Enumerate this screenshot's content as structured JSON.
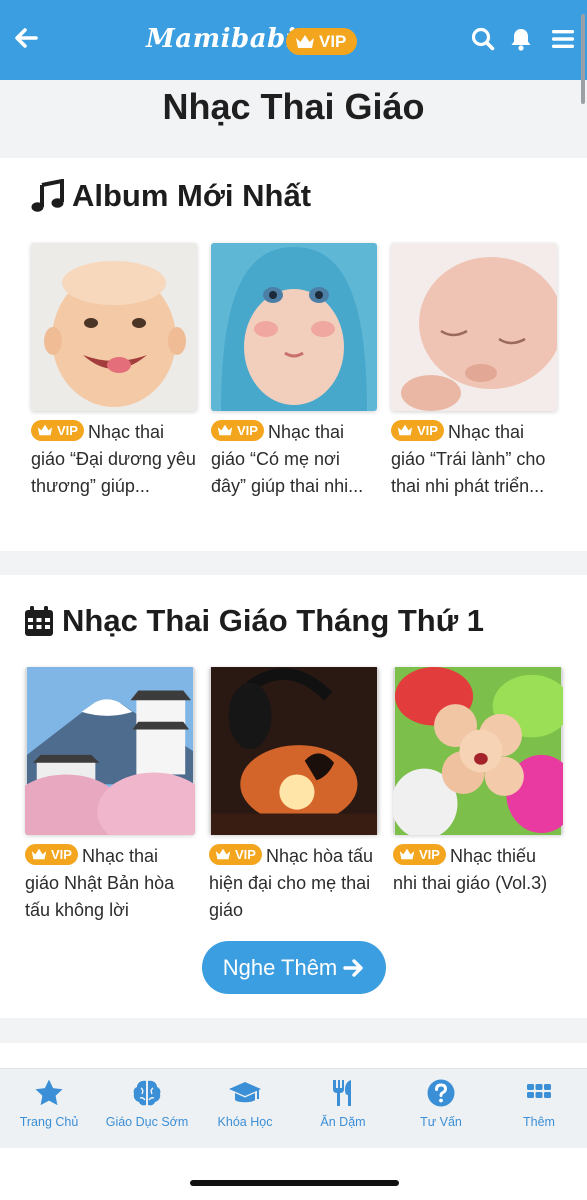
{
  "header": {
    "logo": "Mamibabi",
    "vip_label": "VIP"
  },
  "page": {
    "title": "Nhạc Thai Giáo"
  },
  "sections": [
    {
      "title": "Album Mới Nhất",
      "albums": [
        {
          "badge": "VIP",
          "title": "Nhạc thai giáo “Đại dương yêu thương” giúp..."
        },
        {
          "badge": "VIP",
          "title": "Nhạc thai giáo “Có mẹ nơi đây” giúp thai nhi..."
        },
        {
          "badge": "VIP",
          "title": "Nhạc thai giáo “Trái lành” cho thai nhi phát triển..."
        }
      ]
    },
    {
      "title": "Nhạc Thai Giáo Tháng Thứ 1",
      "albums": [
        {
          "badge": "VIP",
          "title": "Nhạc thai giáo Nhật Bản hòa tấu không lời"
        },
        {
          "badge": "VIP",
          "title": "Nhạc hòa tấu hiện đại cho mẹ thai giáo"
        },
        {
          "badge": "VIP",
          "title": "Nhạc thiếu nhi thai giáo (Vol.3)"
        }
      ],
      "more_label": "Nghe Thêm"
    }
  ],
  "bottom_nav": [
    {
      "label": "Trang Chủ",
      "icon": "star-icon"
    },
    {
      "label": "Giáo Dục Sớm",
      "icon": "brain-icon"
    },
    {
      "label": "Khóa Học",
      "icon": "graduation-cap-icon"
    },
    {
      "label": "Ăn Dặm",
      "icon": "utensils-icon"
    },
    {
      "label": "Tư Vấn",
      "icon": "question-circle-icon"
    },
    {
      "label": "Thêm",
      "icon": "grid-icon"
    }
  ],
  "colors": {
    "brand": "#3b9ee0",
    "vip": "#f2a51d",
    "nav_text": "#3b8fd6"
  }
}
